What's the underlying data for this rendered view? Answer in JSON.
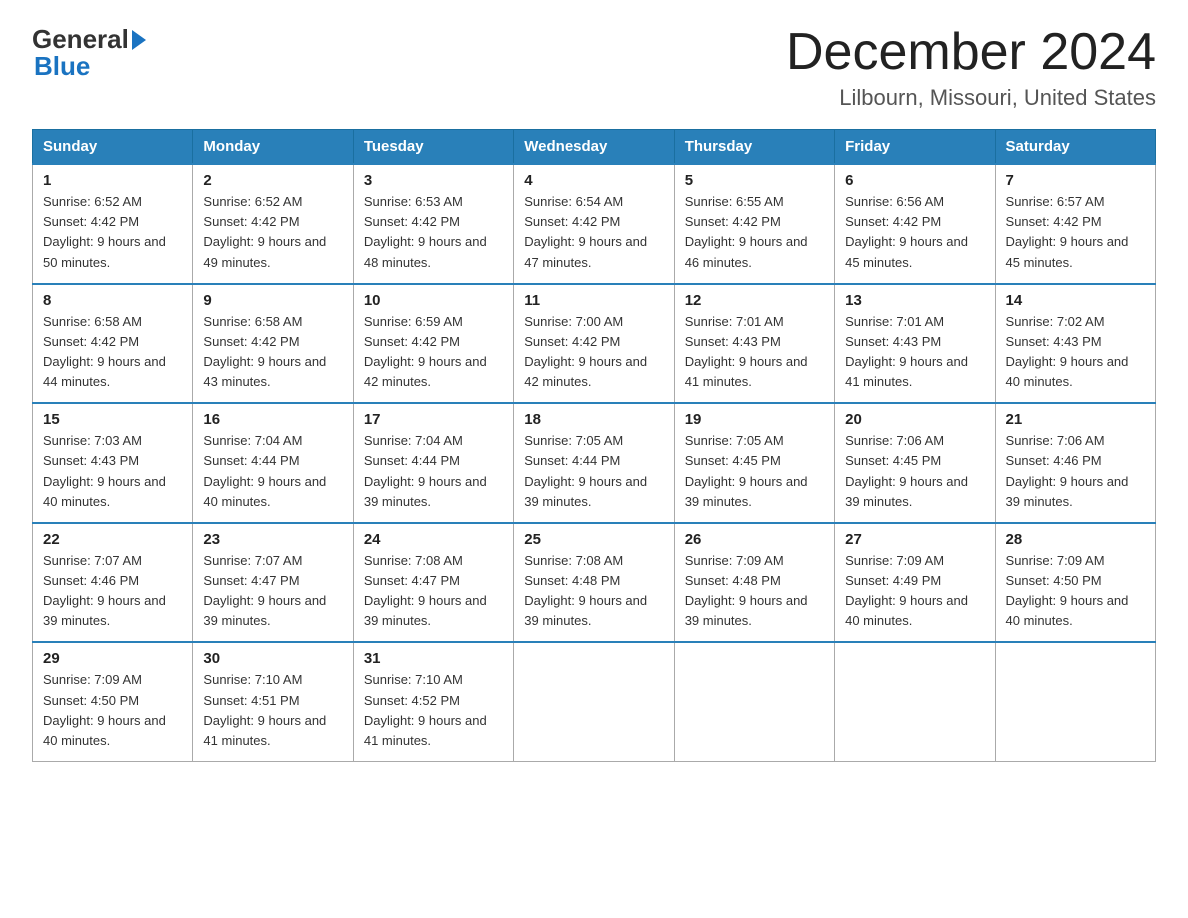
{
  "header": {
    "title": "December 2024",
    "location": "Lilbourn, Missouri, United States",
    "logo_general": "General",
    "logo_blue": "Blue"
  },
  "days_of_week": [
    "Sunday",
    "Monday",
    "Tuesday",
    "Wednesday",
    "Thursday",
    "Friday",
    "Saturday"
  ],
  "weeks": [
    [
      {
        "day": "1",
        "sunrise": "6:52 AM",
        "sunset": "4:42 PM",
        "daylight": "9 hours and 50 minutes."
      },
      {
        "day": "2",
        "sunrise": "6:52 AM",
        "sunset": "4:42 PM",
        "daylight": "9 hours and 49 minutes."
      },
      {
        "day": "3",
        "sunrise": "6:53 AM",
        "sunset": "4:42 PM",
        "daylight": "9 hours and 48 minutes."
      },
      {
        "day": "4",
        "sunrise": "6:54 AM",
        "sunset": "4:42 PM",
        "daylight": "9 hours and 47 minutes."
      },
      {
        "day": "5",
        "sunrise": "6:55 AM",
        "sunset": "4:42 PM",
        "daylight": "9 hours and 46 minutes."
      },
      {
        "day": "6",
        "sunrise": "6:56 AM",
        "sunset": "4:42 PM",
        "daylight": "9 hours and 45 minutes."
      },
      {
        "day": "7",
        "sunrise": "6:57 AM",
        "sunset": "4:42 PM",
        "daylight": "9 hours and 45 minutes."
      }
    ],
    [
      {
        "day": "8",
        "sunrise": "6:58 AM",
        "sunset": "4:42 PM",
        "daylight": "9 hours and 44 minutes."
      },
      {
        "day": "9",
        "sunrise": "6:58 AM",
        "sunset": "4:42 PM",
        "daylight": "9 hours and 43 minutes."
      },
      {
        "day": "10",
        "sunrise": "6:59 AM",
        "sunset": "4:42 PM",
        "daylight": "9 hours and 42 minutes."
      },
      {
        "day": "11",
        "sunrise": "7:00 AM",
        "sunset": "4:42 PM",
        "daylight": "9 hours and 42 minutes."
      },
      {
        "day": "12",
        "sunrise": "7:01 AM",
        "sunset": "4:43 PM",
        "daylight": "9 hours and 41 minutes."
      },
      {
        "day": "13",
        "sunrise": "7:01 AM",
        "sunset": "4:43 PM",
        "daylight": "9 hours and 41 minutes."
      },
      {
        "day": "14",
        "sunrise": "7:02 AM",
        "sunset": "4:43 PM",
        "daylight": "9 hours and 40 minutes."
      }
    ],
    [
      {
        "day": "15",
        "sunrise": "7:03 AM",
        "sunset": "4:43 PM",
        "daylight": "9 hours and 40 minutes."
      },
      {
        "day": "16",
        "sunrise": "7:04 AM",
        "sunset": "4:44 PM",
        "daylight": "9 hours and 40 minutes."
      },
      {
        "day": "17",
        "sunrise": "7:04 AM",
        "sunset": "4:44 PM",
        "daylight": "9 hours and 39 minutes."
      },
      {
        "day": "18",
        "sunrise": "7:05 AM",
        "sunset": "4:44 PM",
        "daylight": "9 hours and 39 minutes."
      },
      {
        "day": "19",
        "sunrise": "7:05 AM",
        "sunset": "4:45 PM",
        "daylight": "9 hours and 39 minutes."
      },
      {
        "day": "20",
        "sunrise": "7:06 AM",
        "sunset": "4:45 PM",
        "daylight": "9 hours and 39 minutes."
      },
      {
        "day": "21",
        "sunrise": "7:06 AM",
        "sunset": "4:46 PM",
        "daylight": "9 hours and 39 minutes."
      }
    ],
    [
      {
        "day": "22",
        "sunrise": "7:07 AM",
        "sunset": "4:46 PM",
        "daylight": "9 hours and 39 minutes."
      },
      {
        "day": "23",
        "sunrise": "7:07 AM",
        "sunset": "4:47 PM",
        "daylight": "9 hours and 39 minutes."
      },
      {
        "day": "24",
        "sunrise": "7:08 AM",
        "sunset": "4:47 PM",
        "daylight": "9 hours and 39 minutes."
      },
      {
        "day": "25",
        "sunrise": "7:08 AM",
        "sunset": "4:48 PM",
        "daylight": "9 hours and 39 minutes."
      },
      {
        "day": "26",
        "sunrise": "7:09 AM",
        "sunset": "4:48 PM",
        "daylight": "9 hours and 39 minutes."
      },
      {
        "day": "27",
        "sunrise": "7:09 AM",
        "sunset": "4:49 PM",
        "daylight": "9 hours and 40 minutes."
      },
      {
        "day": "28",
        "sunrise": "7:09 AM",
        "sunset": "4:50 PM",
        "daylight": "9 hours and 40 minutes."
      }
    ],
    [
      {
        "day": "29",
        "sunrise": "7:09 AM",
        "sunset": "4:50 PM",
        "daylight": "9 hours and 40 minutes."
      },
      {
        "day": "30",
        "sunrise": "7:10 AM",
        "sunset": "4:51 PM",
        "daylight": "9 hours and 41 minutes."
      },
      {
        "day": "31",
        "sunrise": "7:10 AM",
        "sunset": "4:52 PM",
        "daylight": "9 hours and 41 minutes."
      },
      null,
      null,
      null,
      null
    ]
  ]
}
